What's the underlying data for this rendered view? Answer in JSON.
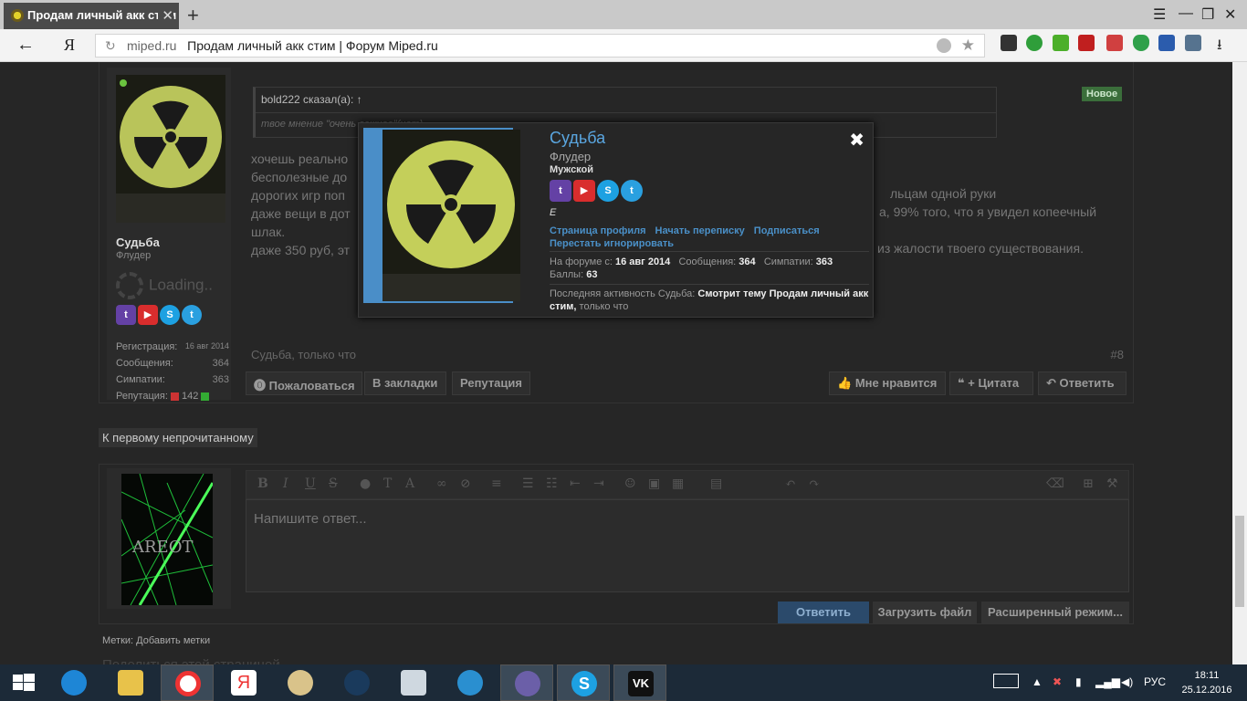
{
  "browser": {
    "tab_title": "Продам личный акк стим",
    "url_domain": "miped.ru",
    "page_title": "Продам личный акк стим | Форум Miped.ru",
    "yandex_label": "Я"
  },
  "post": {
    "user": {
      "name": "Судьба",
      "title": "Флудер",
      "loading": "Loading.."
    },
    "stats": [
      {
        "label": "Регистрация:",
        "value": "16 авг 2014"
      },
      {
        "label": "Сообщения:",
        "value": "364"
      },
      {
        "label": "Симпатии:",
        "value": "363"
      },
      {
        "label": "Репутация:",
        "value": "142"
      }
    ],
    "quote_header": "bold222 сказал(а): ↑",
    "quote_body": "твое мнение \"очень важное\"(нет)",
    "new_badge": "Новое",
    "message_lines": [
      "хочешь реально",
      "бесполезные до",
      "дорогих игр поп",
      "даже вещи в дот",
      "шлак.",
      "даже 350 руб, эт"
    ],
    "message_tails": [
      "льцам одной руки",
      "а, 99% того, что я увидел копеечный",
      "из жалости твоего существования."
    ],
    "signature": "Судьба, только что",
    "post_number": "#8",
    "actions_left": [
      "Пожаловаться",
      "В закладки",
      "Репутация"
    ],
    "actions_right": [
      "Мне нравится",
      "+ Цитата",
      "Ответить"
    ]
  },
  "first_unread": "К первому непрочитанному",
  "reply": {
    "avatar_text": "AREOT",
    "placeholder": "Напишите ответ...",
    "buttons": {
      "reply": "Ответить",
      "upload": "Загрузить файл",
      "advanced": "Расширенный режим..."
    },
    "tags_label": "Метки:",
    "tags_add": "Добавить метки",
    "cutoff_text": "Поделиться этой страницей"
  },
  "popup": {
    "name": "Судьба",
    "title": "Флудер",
    "gender": "Мужской",
    "status": "E",
    "links": [
      "Страница профиля",
      "Начать переписку",
      "Подписаться",
      "Перестать игнорировать"
    ],
    "stats": {
      "since_label": "На форуме с:",
      "since_value": "16 авг 2014",
      "messages_label": "Сообщения:",
      "messages_value": "364",
      "likes_label": "Симпатии:",
      "likes_value": "363",
      "points_label": "Баллы:",
      "points_value": "63"
    },
    "activity_prefix": "Последняя активность Судьба:",
    "activity_bold": "Смотрит тему Продам личный акк стим,",
    "activity_suffix": "только что"
  },
  "taskbar": {
    "lang": "РУС",
    "time": "18:11",
    "date": "25.12.2016"
  },
  "colors": {
    "accent": "#5aa6e0",
    "page_bg": "#262626",
    "new_badge": "#3b6e3b",
    "reply_button": "#2b4a6b"
  }
}
